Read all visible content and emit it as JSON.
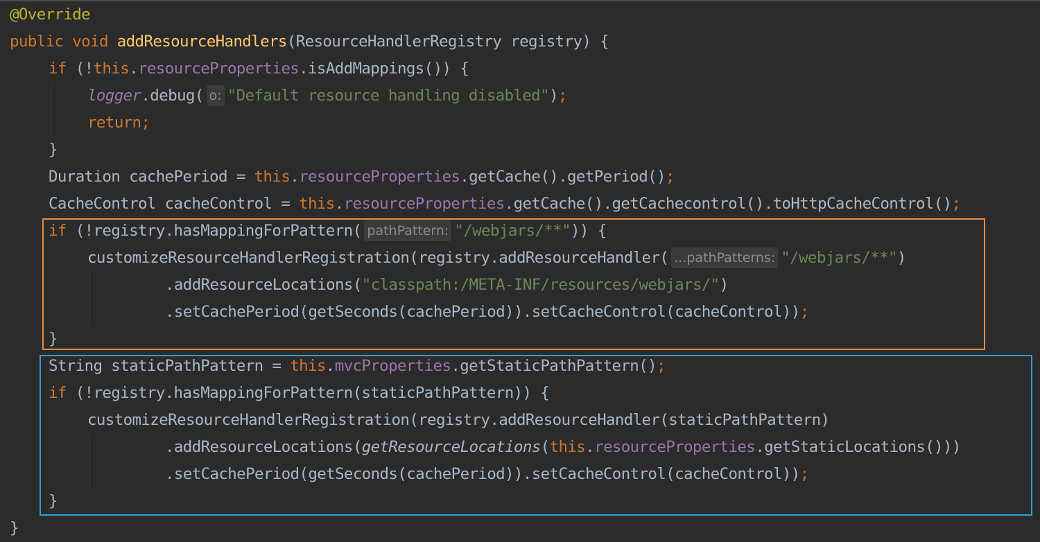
{
  "editor": {
    "lines": [
      {
        "indent": 0,
        "tokens": [
          {
            "t": "@Override",
            "c": "ann"
          }
        ]
      },
      {
        "indent": 0,
        "tokens": [
          {
            "t": "public void ",
            "c": "kw"
          },
          {
            "t": "addResourceHandlers",
            "c": "fn"
          },
          {
            "t": "(ResourceHandlerRegistry registry) {",
            "c": "plain"
          }
        ]
      },
      {
        "indent": 1,
        "tokens": [
          {
            "t": "if ",
            "c": "kw"
          },
          {
            "t": "(!",
            "c": "plain"
          },
          {
            "t": "this",
            "c": "kw"
          },
          {
            "t": ".",
            "c": "plain"
          },
          {
            "t": "resourceProperties",
            "c": "field"
          },
          {
            "t": ".isAddMappings()) {",
            "c": "plain"
          }
        ]
      },
      {
        "indent": 2,
        "tokens": [
          {
            "t": "logger",
            "c": "sfield"
          },
          {
            "t": ".debug(",
            "c": "plain"
          },
          {
            "t": "o:",
            "c": "hint"
          },
          {
            "t": "\"Default resource handling disabled\"",
            "c": "str"
          },
          {
            "t": ")",
            "c": "plain"
          },
          {
            "t": ";",
            "c": "kw"
          }
        ]
      },
      {
        "indent": 2,
        "tokens": [
          {
            "t": "return",
            "c": "kw"
          },
          {
            "t": ";",
            "c": "kw"
          }
        ]
      },
      {
        "indent": 1,
        "tokens": [
          {
            "t": "}",
            "c": "plain"
          }
        ]
      },
      {
        "indent": 1,
        "tokens": [
          {
            "t": "Duration cachePeriod = ",
            "c": "plain"
          },
          {
            "t": "this",
            "c": "kw"
          },
          {
            "t": ".",
            "c": "plain"
          },
          {
            "t": "resourceProperties",
            "c": "field"
          },
          {
            "t": ".getCache().getPeriod()",
            "c": "plain"
          },
          {
            "t": ";",
            "c": "kw"
          }
        ]
      },
      {
        "indent": 1,
        "tokens": [
          {
            "t": "CacheControl cacheControl = ",
            "c": "plain"
          },
          {
            "t": "this",
            "c": "kw"
          },
          {
            "t": ".",
            "c": "plain"
          },
          {
            "t": "resourceProperties",
            "c": "field"
          },
          {
            "t": ".getCache().getCachecontrol().toHttpCacheControl()",
            "c": "plain"
          },
          {
            "t": ";",
            "c": "kw"
          }
        ]
      },
      {
        "indent": 1,
        "tokens": [
          {
            "t": "if ",
            "c": "kw"
          },
          {
            "t": "(!registry.hasMappingForPattern(",
            "c": "plain"
          },
          {
            "t": "pathPattern:",
            "c": "hint"
          },
          {
            "t": "\"/webjars/**\"",
            "c": "str"
          },
          {
            "t": ")) {",
            "c": "plain"
          }
        ]
      },
      {
        "indent": 2,
        "tokens": [
          {
            "t": "customizeResourceHandlerRegistration(registry.addResourceHandler(",
            "c": "plain"
          },
          {
            "t": "...pathPatterns:",
            "c": "hint"
          },
          {
            "t": "\"/webjars/**\"",
            "c": "str"
          },
          {
            "t": ")",
            "c": "plain"
          }
        ]
      },
      {
        "indent": 4,
        "tokens": [
          {
            "t": ".addResourceLocations(",
            "c": "plain"
          },
          {
            "t": "\"classpath:/META-INF/resources/webjars/\"",
            "c": "str"
          },
          {
            "t": ")",
            "c": "plain"
          }
        ]
      },
      {
        "indent": 4,
        "tokens": [
          {
            "t": ".setCachePeriod(getSeconds(cachePeriod)).setCacheControl(cacheControl))",
            "c": "plain"
          },
          {
            "t": ";",
            "c": "kw"
          }
        ]
      },
      {
        "indent": 1,
        "tokens": [
          {
            "t": "}",
            "c": "plain"
          }
        ]
      },
      {
        "indent": 1,
        "tokens": [
          {
            "t": "String staticPathPattern = ",
            "c": "plain"
          },
          {
            "t": "this",
            "c": "kw"
          },
          {
            "t": ".",
            "c": "plain"
          },
          {
            "t": "mvcProperties",
            "c": "field"
          },
          {
            "t": ".getStaticPathPattern()",
            "c": "plain"
          },
          {
            "t": ";",
            "c": "kw"
          }
        ]
      },
      {
        "indent": 1,
        "tokens": [
          {
            "t": "if ",
            "c": "kw"
          },
          {
            "t": "(!registry.hasMappingForPattern(staticPathPattern)) {",
            "c": "plain"
          }
        ]
      },
      {
        "indent": 2,
        "tokens": [
          {
            "t": "customizeResourceHandlerRegistration(registry.addResourceHandler(staticPathPattern)",
            "c": "plain"
          }
        ]
      },
      {
        "indent": 4,
        "tokens": [
          {
            "t": ".addResourceLocations(",
            "c": "plain"
          },
          {
            "t": "getResourceLocations",
            "c": "italic"
          },
          {
            "t": "(",
            "c": "plain"
          },
          {
            "t": "this",
            "c": "kw"
          },
          {
            "t": ".",
            "c": "plain"
          },
          {
            "t": "resourceProperties",
            "c": "field"
          },
          {
            "t": ".getStaticLocations()))",
            "c": "plain"
          }
        ]
      },
      {
        "indent": 4,
        "tokens": [
          {
            "t": ".setCachePeriod(getSeconds(cachePeriod)).setCacheControl(cacheControl))",
            "c": "plain"
          },
          {
            "t": ";",
            "c": "kw"
          }
        ]
      },
      {
        "indent": 1,
        "tokens": [
          {
            "t": "}",
            "c": "plain"
          }
        ]
      },
      {
        "indent": 0,
        "tokens": [
          {
            "t": "}",
            "c": "plain"
          }
        ]
      }
    ]
  },
  "highlights": [
    {
      "name": "webjars-block",
      "color": "#e98a3b"
    },
    {
      "name": "static-path-block",
      "color": "#2f9fd8"
    }
  ],
  "theme": {
    "background": "#2b2b2b",
    "keyword": "#cc7832",
    "method": "#ffc66d",
    "field": "#9876aa",
    "string": "#6a8759",
    "annotation": "#bbb529",
    "text": "#a9b7c6"
  }
}
